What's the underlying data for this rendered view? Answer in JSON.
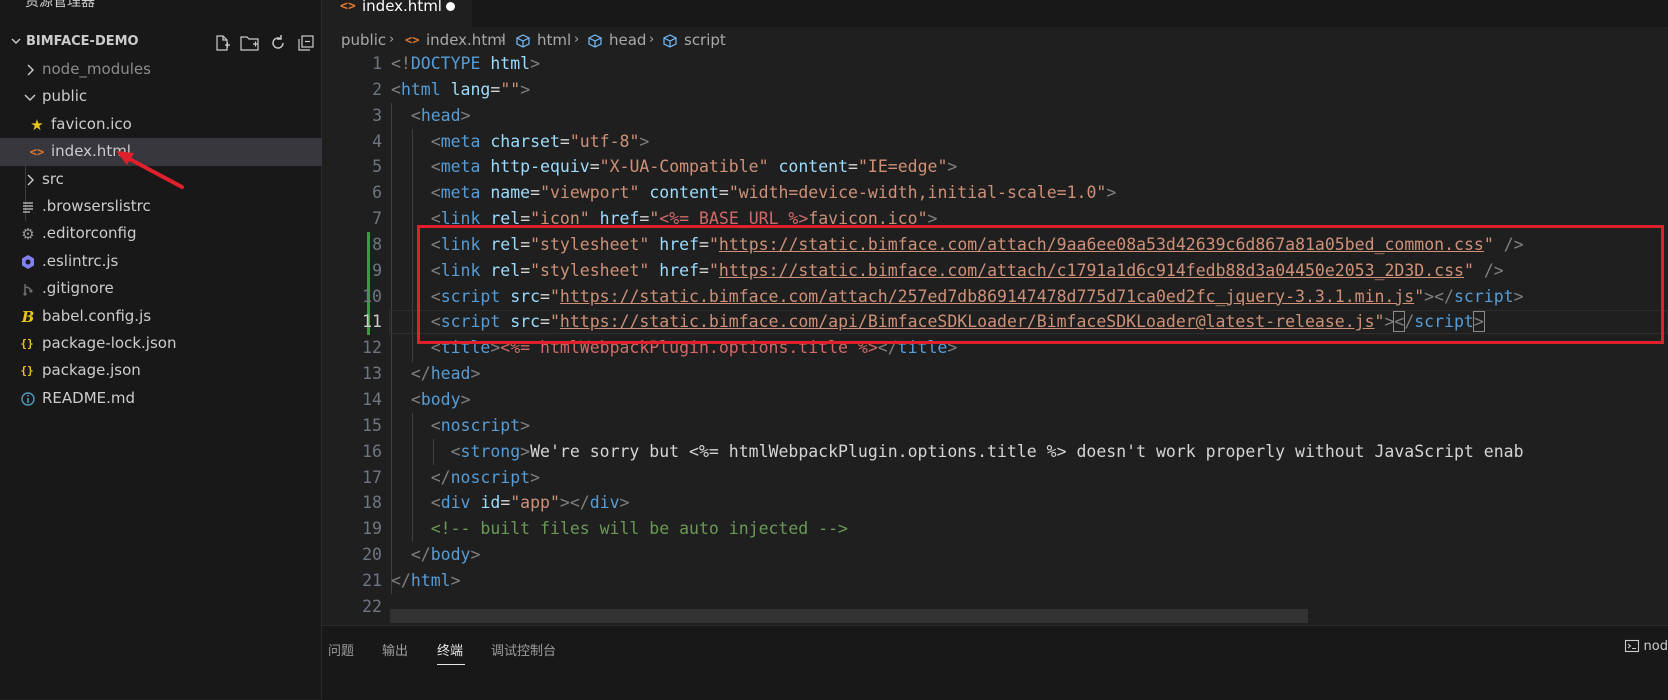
{
  "explorer": {
    "title": "资源管理器",
    "more": "···",
    "project": "BIMFACE-DEMO",
    "items": [
      {
        "label": "node_modules",
        "kind": "folder",
        "icon": "chevron-right-icon"
      },
      {
        "label": "public",
        "kind": "folder-open",
        "icon": "chevron-down-icon"
      },
      {
        "label": "favicon.ico",
        "kind": "file",
        "icon": "star-icon"
      },
      {
        "label": "index.html",
        "kind": "file",
        "icon": "html-file-icon"
      },
      {
        "label": "src",
        "kind": "folder",
        "icon": "chevron-right-icon"
      },
      {
        "label": ".browserslistrc",
        "kind": "file",
        "icon": "list-file-icon"
      },
      {
        "label": ".editorconfig",
        "kind": "file",
        "icon": "gear-icon"
      },
      {
        "label": ".eslintrc.js",
        "kind": "file",
        "icon": "eslint-icon"
      },
      {
        "label": ".gitignore",
        "kind": "file",
        "icon": "git-icon"
      },
      {
        "label": "babel.config.js",
        "kind": "file",
        "icon": "babel-icon"
      },
      {
        "label": "package-lock.json",
        "kind": "file",
        "icon": "json-icon"
      },
      {
        "label": "package.json",
        "kind": "file",
        "icon": "json-icon"
      },
      {
        "label": "README.md",
        "kind": "file",
        "icon": "info-icon"
      }
    ]
  },
  "editor": {
    "tab": {
      "label": "index.html",
      "icon": "html-file-icon",
      "modified": true
    },
    "breadcrumb": [
      "public",
      "index.html",
      "html",
      "head",
      "script"
    ],
    "line_numbers": [
      "1",
      "2",
      "3",
      "4",
      "5",
      "6",
      "7",
      "8",
      "9",
      "10",
      "11",
      "12",
      "13",
      "14",
      "15",
      "16",
      "17",
      "18",
      "19",
      "20",
      "21",
      "22"
    ],
    "current_line": 11,
    "code": {
      "l1_doctype": "DOCTYPE",
      "l1_html": "html",
      "l2_tag": "html",
      "l2_attr": "lang",
      "l2_val": "\"\"",
      "head": "head",
      "meta": "meta",
      "link": "link",
      "script": "script",
      "title": "title",
      "body": "body",
      "noscript": "noscript",
      "strong": "strong",
      "div": "div",
      "charset": "charset",
      "utf8": "\"utf-8\"",
      "http_equiv": "http-equiv",
      "xua": "\"X-UA-Compatible\"",
      "content": "content",
      "ie_edge": "\"IE=edge\"",
      "name": "name",
      "viewport": "\"viewport\"",
      "viewport_content": "\"width=device-width,initial-scale=1.0\"",
      "rel": "rel",
      "icon_val": "\"icon\"",
      "href": "href",
      "q": "\"",
      "base_url_expr": "<%= BASE_URL %>",
      "favicon": "favicon.ico",
      "stylesheet": "\"stylesheet\"",
      "css1": "https://static.bimface.com/attach/9aa6ee08a53d42639c6d867a81a05bed_common.css",
      "css2": "https://static.bimface.com/attach/c1791a1d6c914fedb88d3a04450e2053_2D3D.css",
      "src": "src",
      "js1": "https://static.bimface.com/attach/257ed7db869147478d775d71ca0ed2fc_jquery-3.3.1.min.js",
      "js2": "https://static.bimface.com/api/BimfaceSDKLoader/BimfaceSDKLoader@latest-release.js",
      "title_expr": "<%= htmlWebpackPlugin.options.title %>",
      "sorry_1": "We're sorry but ",
      "sorry_expr": "<%= htmlWebpackPlugin.options.title %>",
      "sorry_2": " doesn't work properly without JavaScript enab",
      "id": "id",
      "app": "\"app\"",
      "comment": "<!-- built files will be auto injected -->"
    }
  },
  "panel": {
    "tabs": [
      "问题",
      "输出",
      "终端",
      "调试控制台"
    ],
    "active_tab": "终端",
    "terminal": "nod"
  },
  "colors": {
    "annotation_red": "#e0202a",
    "tag_blue": "#569cd6",
    "attr_lightblue": "#9cdcfe",
    "string_orange": "#ce9178",
    "comment_green": "#6a9955"
  }
}
